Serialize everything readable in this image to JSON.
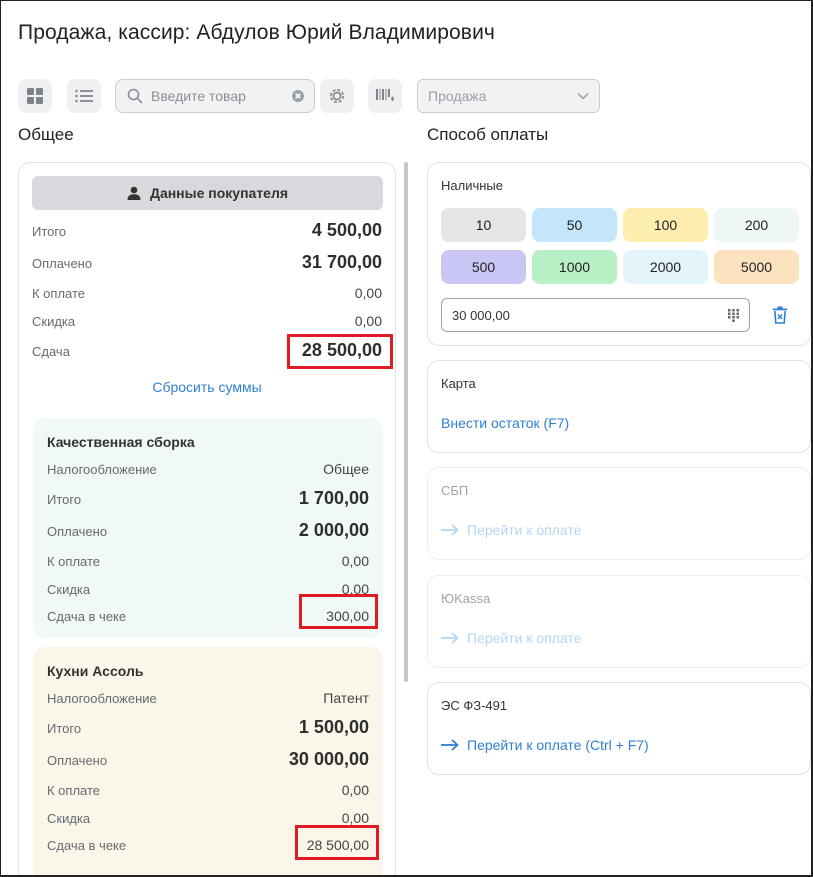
{
  "title": "Продажа, кассир: Абдулов Юрий Владимирович",
  "toolbar": {
    "search_placeholder": "Введите товар",
    "mode_select_value": "Продажа",
    "icons": [
      "grid-view-icon",
      "list-view-icon",
      "search-icon",
      "clear-icon",
      "gear-icon",
      "barcode-icon",
      "chevron-down-icon"
    ]
  },
  "summary": {
    "section_title": "Общее",
    "customer_button": "Данные покупателя",
    "rows": [
      {
        "label": "Итого",
        "value": "4 500,00"
      },
      {
        "label": "Оплачено",
        "value": "31 700,00"
      },
      {
        "label": "К оплате",
        "value": "0,00"
      },
      {
        "label": "Скидка",
        "value": "0,00"
      },
      {
        "label": "Сдача",
        "value": "28 500,00"
      }
    ],
    "reset_label": "Сбросить суммы"
  },
  "orgs": [
    {
      "name": "Качественная сборка",
      "color": "#f1f9f6",
      "tax_label": "Налогообложение",
      "tax_value": "Общее",
      "rows": [
        {
          "label": "Итого",
          "value": "1 700,00"
        },
        {
          "label": "Оплачено",
          "value": "2 000,00"
        },
        {
          "label": "К оплате",
          "value": "0,00"
        },
        {
          "label": "Скидка",
          "value": "0,00"
        },
        {
          "label": "Сдача в чеке",
          "value": "300,00"
        }
      ]
    },
    {
      "name": "Кухни Ассоль",
      "color": "#fbf6ea",
      "tax_label": "Налогообложение",
      "tax_value": "Патент",
      "rows": [
        {
          "label": "Итого",
          "value": "1 500,00"
        },
        {
          "label": "Оплачено",
          "value": "30 000,00"
        },
        {
          "label": "К оплате",
          "value": "0,00"
        },
        {
          "label": "Скидка",
          "value": "0,00"
        },
        {
          "label": "Сдача в чеке",
          "value": "28 500,00"
        }
      ]
    }
  ],
  "payment": {
    "section_title": "Способ оплаты",
    "cash": {
      "name": "Наличные",
      "denominations": [
        {
          "label": "10",
          "color": "#e4e5e7"
        },
        {
          "label": "50",
          "color": "#c3e6fb"
        },
        {
          "label": "100",
          "color": "#fdeeb0"
        },
        {
          "label": "200",
          "color": "#eef7f5"
        },
        {
          "label": "500",
          "color": "#c9c6f3"
        },
        {
          "label": "1000",
          "color": "#b8efc4"
        },
        {
          "label": "2000",
          "color": "#e4f4fb"
        },
        {
          "label": "5000",
          "color": "#fde2bf"
        }
      ],
      "input_value": "30 000,00"
    },
    "card": {
      "name": "Карта",
      "link": "Внести остаток (F7)"
    },
    "sbp": {
      "name": "СБП",
      "link": "Перейти к оплате"
    },
    "yukassa": {
      "name": "ЮKassa",
      "link": "Перейти к оплате"
    },
    "es": {
      "name": "ЭС ФЗ-491",
      "link": "Перейти к оплате (Ctrl + F7)"
    }
  },
  "colors": {
    "accent": "#2f80d1",
    "highlight": "#e01b24"
  }
}
